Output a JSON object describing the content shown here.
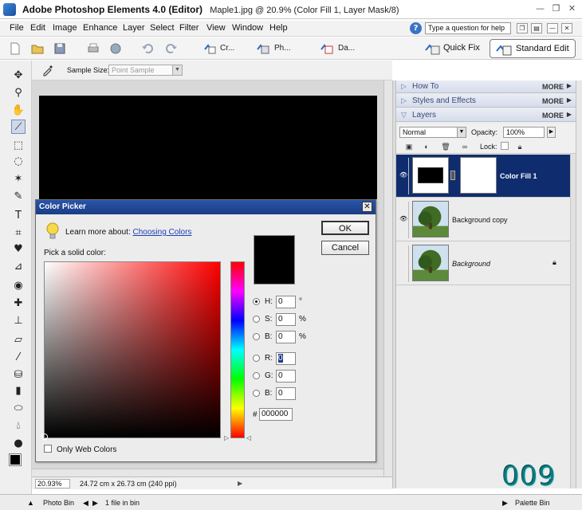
{
  "window": {
    "title_app": "Adobe Photoshop Elements 4.0 (Editor)",
    "title_doc": "Maple1.jpg @ 20.9% (Color Fill 1, Layer Mask/8)",
    "min_glyph": "—",
    "max_glyph": "❐",
    "close_glyph": "✕"
  },
  "menu": {
    "items": [
      "File",
      "Edit",
      "Image",
      "Enhance",
      "Layer",
      "Select",
      "Filter",
      "View",
      "Window",
      "Help"
    ],
    "question_placeholder": "Type a question for help"
  },
  "toolbar": {
    "create_label": "Cr...",
    "photo_label": "Ph...",
    "date_label": "Da...",
    "quick_fix_label": "Quick Fix",
    "standard_edit_label": "Standard Edit"
  },
  "options": {
    "sample_size_label": "Sample Size:",
    "sample_size_value": "Point Sample"
  },
  "status": {
    "zoom": "20.93%",
    "dimensions": "24.72 cm x 26.73 cm (240 ppi)"
  },
  "bottom_bar": {
    "photo_bin_label": "Photo Bin",
    "files_label": "1 file in bin",
    "palette_bin_label": "Palette Bin"
  },
  "palette": {
    "sections": [
      {
        "name": "How To",
        "more": "MORE"
      },
      {
        "name": "Styles and Effects",
        "more": "MORE"
      },
      {
        "name": "Layers",
        "more": "MORE"
      }
    ],
    "blend_mode": "Normal",
    "opacity_label": "Opacity:",
    "opacity_value": "100%",
    "lock_label": "Lock:",
    "layers": [
      {
        "name": "Color Fill 1",
        "selected": true
      },
      {
        "name": "Background copy",
        "selected": false
      },
      {
        "name": "Background",
        "selected": false
      }
    ]
  },
  "color_picker": {
    "title": "Color Picker",
    "learn_prefix": "Learn more about:",
    "learn_link": "Choosing Colors",
    "pick_label": "Pick a solid color:",
    "ok_label": "OK",
    "cancel_label": "Cancel",
    "only_web_label": "Only Web Colors",
    "fields": [
      {
        "label": "H:",
        "value": "0",
        "unit": "°",
        "checked": true
      },
      {
        "label": "S:",
        "value": "0",
        "unit": "%",
        "checked": false
      },
      {
        "label": "B:",
        "value": "0",
        "unit": "%",
        "checked": false
      },
      {
        "label": "R:",
        "value": "0",
        "unit": "",
        "checked": false
      },
      {
        "label": "G:",
        "value": "0",
        "unit": "",
        "checked": false
      },
      {
        "label": "B:",
        "value": "0",
        "unit": "",
        "checked": false
      }
    ],
    "hex_label": "#",
    "hex_value": "000000",
    "current_color": "#000000"
  },
  "watermark": "009",
  "colors": {
    "selected_layer": "#0f2d6e",
    "dialog_title": "#1b3d86",
    "link": "#1c3fb0",
    "watermark": "#0d7a80"
  }
}
